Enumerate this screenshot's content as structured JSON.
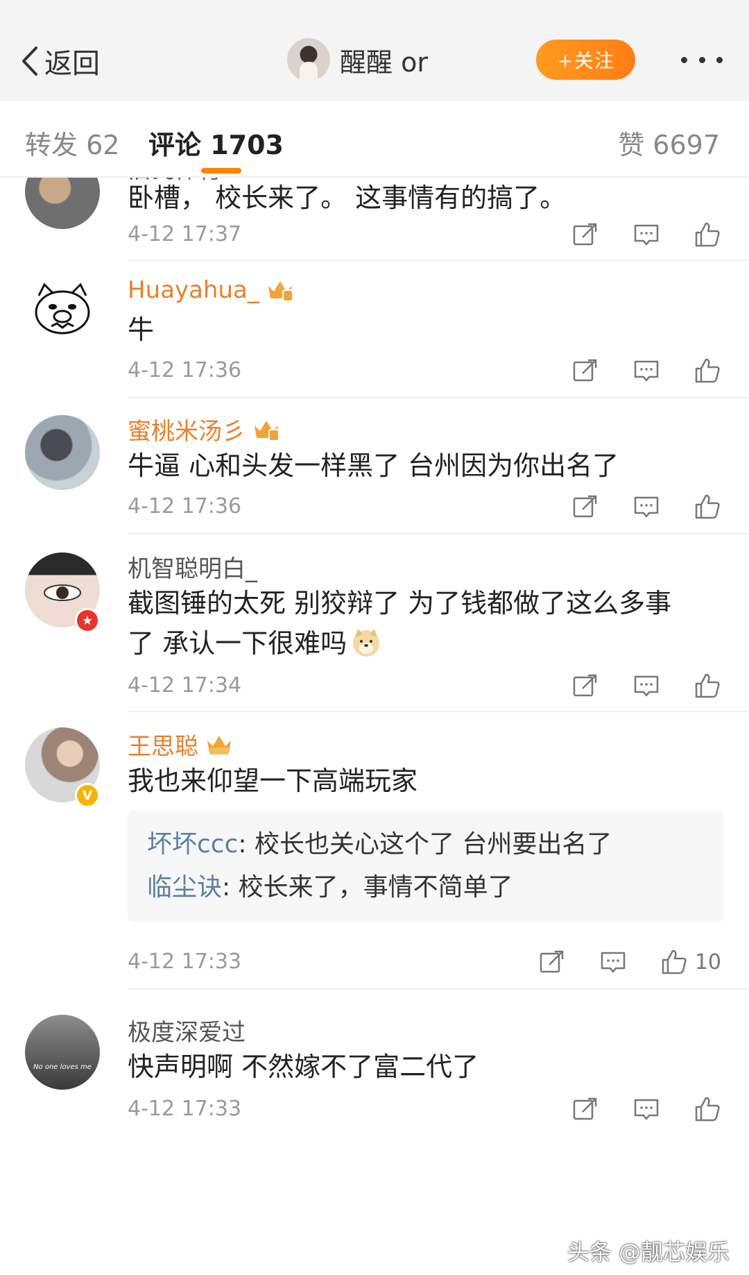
{
  "header": {
    "back_label": "返回",
    "profile_name": "醒醒 or",
    "follow_label": "+关注"
  },
  "tabs": {
    "repost": "转发 62",
    "comments": "评论 1703",
    "likes": "赞 6697"
  },
  "comments": [
    {
      "username": "旧戈体育",
      "text": "卧槽， 校长来了。 这事情有的搞了。",
      "time": "4-12 17:37"
    },
    {
      "username": "Huayahua_",
      "text": "牛",
      "time": "4-12 17:36"
    },
    {
      "username": "蜜桃米汤彡",
      "text": "牛逼 心和头发一样黑了 台州因为你出名了",
      "time": "4-12 17:36"
    },
    {
      "username": "机智聪明白_",
      "text_line1": "截图锤的太死 别狡辩了  为了钱都做了这么多事",
      "text_line2": "了  承认一下很难吗",
      "time": "4-12 17:34"
    },
    {
      "username": "王思聪",
      "text": "我也来仰望一下高端玩家",
      "replies": [
        {
          "name": "坏坏ccc",
          "text": ": 校长也关心这个了 台州要出名了"
        },
        {
          "name": "临尘诀",
          "text": ": 校长来了，事情不简单了"
        }
      ],
      "time": "4-12 17:33",
      "like_count": "10"
    },
    {
      "username": "极度深爱过",
      "text": "快声明啊 不然嫁不了富二代了",
      "time": "4-12 17:33",
      "avatar_caption": "No one loves me"
    }
  ],
  "watermark": "头条 @靓芯娱乐",
  "colors": {
    "accent": "#ff8200",
    "vip_name": "#e8802a",
    "reply_name": "#5b7fa6"
  }
}
